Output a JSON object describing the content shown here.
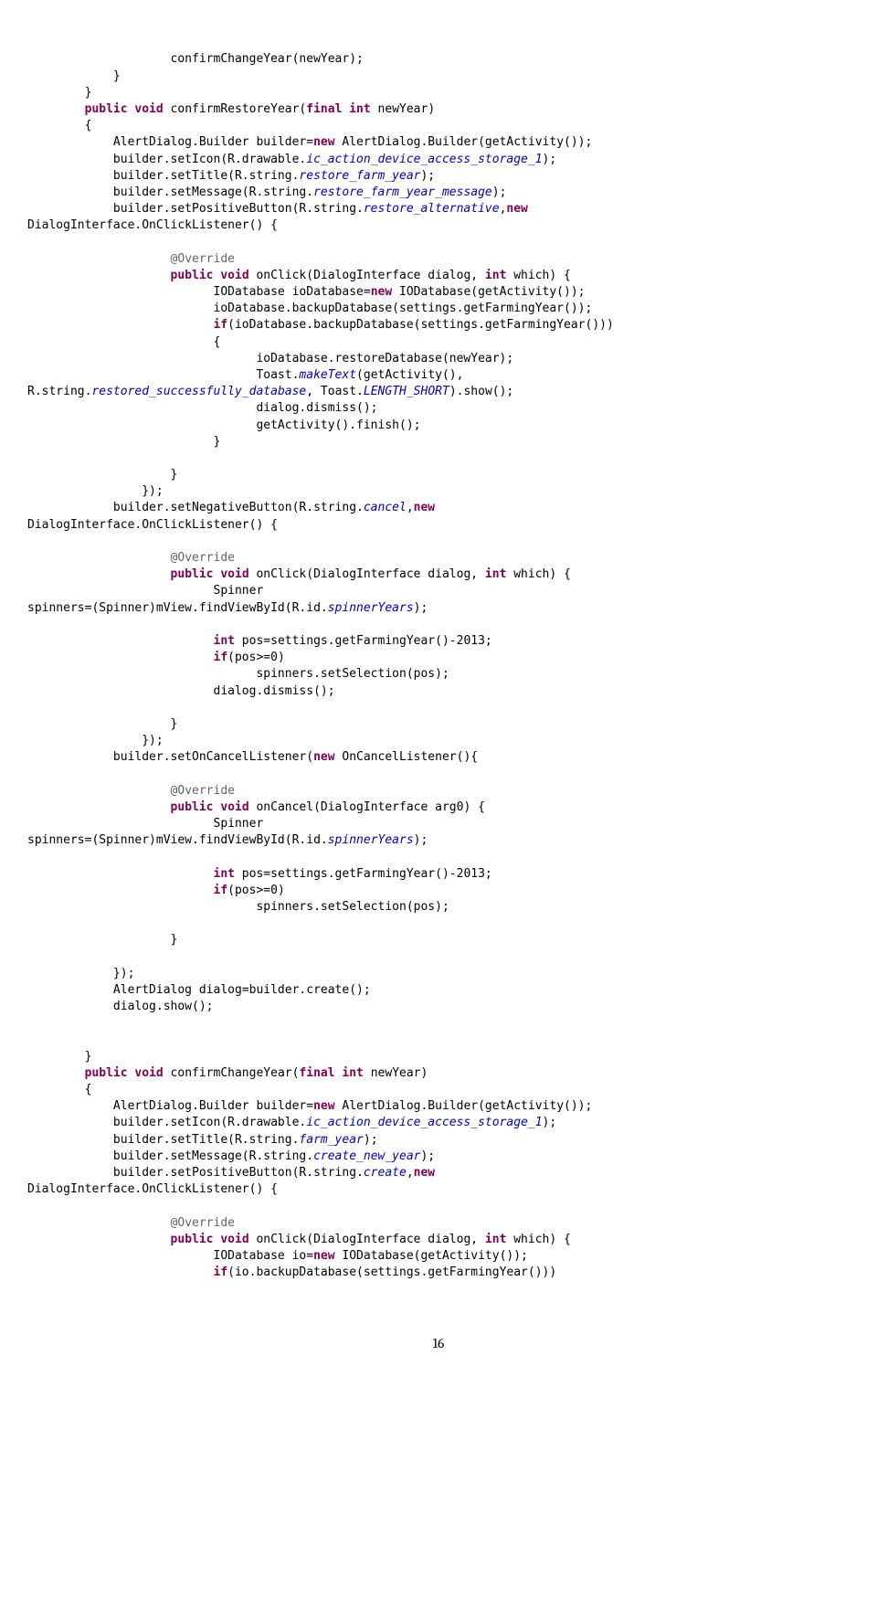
{
  "page_number": "16",
  "t": {
    "l1a": "                    confirmChangeYear(newYear);",
    "l2a": "            }",
    "l3a": "        }",
    "l4a": "        ",
    "l4b": "public void",
    "l4c": " confirmRestoreYear(",
    "l4d": "final int",
    "l4e": " newYear)",
    "l5a": "        {",
    "l6a": "            AlertDialog.Builder builder=",
    "l6b": "new",
    "l6c": " AlertDialog.Builder(getActivity());",
    "l7a": "            builder.setIcon(R.drawable.",
    "l7b": "ic_action_device_access_storage_1",
    "l7c": ");",
    "l8a": "            builder.setTitle(R.string.",
    "l8b": "restore_farm_year",
    "l8c": ");",
    "l9a": "            builder.setMessage(R.string.",
    "l9b": "restore_farm_year_message",
    "l9c": ");",
    "l10a": "            builder.setPositiveButton(R.string.",
    "l10b": "restore_alternative",
    "l10c": ",",
    "l10d": "new",
    "l11a": "DialogInterface.OnClickListener() {",
    "l12a": "",
    "l13a": "                    ",
    "l13b": "@Override",
    "l14a": "                    ",
    "l14b": "public void",
    "l14c": " onClick(DialogInterface dialog, ",
    "l14d": "int",
    "l14e": " which) {",
    "l15a": "                          IODatabase ioDatabase=",
    "l15b": "new",
    "l15c": " IODatabase(getActivity());",
    "l16a": "                          ioDatabase.backupDatabase(settings.getFarmingYear());",
    "l17a": "                          ",
    "l17b": "if",
    "l17c": "(ioDatabase.backupDatabase(settings.getFarmingYear()))",
    "l18a": "                          {",
    "l19a": "                                ioDatabase.restoreDatabase(newYear);",
    "l20a": "                                Toast.",
    "l20b": "makeText",
    "l20c": "(getActivity(),",
    "l21a": "R.string.",
    "l21b": "restored_successfully_database",
    "l21c": ", Toast.",
    "l21d": "LENGTH_SHORT",
    "l21e": ").show();",
    "l22a": "                                dialog.dismiss();",
    "l23a": "                                getActivity().finish();",
    "l24a": "                          }",
    "l25a": "",
    "l26a": "                    }",
    "l27a": "                });",
    "l28a": "            builder.setNegativeButton(R.string.",
    "l28b": "cancel",
    "l28c": ",",
    "l28d": "new",
    "l29a": "DialogInterface.OnClickListener() {",
    "l30a": "",
    "l31a": "                    ",
    "l31b": "@Override",
    "l32a": "                    ",
    "l32b": "public void",
    "l32c": " onClick(DialogInterface dialog, ",
    "l32d": "int",
    "l32e": " which) {",
    "l33a": "                          Spinner",
    "l34a": "spinners=(Spinner)mView.findViewById(R.id.",
    "l34b": "spinnerYears",
    "l34c": ");",
    "l35a": "",
    "l36a": "                          ",
    "l36b": "int",
    "l36c": " pos=settings.getFarmingYear()-2013;",
    "l37a": "                          ",
    "l37b": "if",
    "l37c": "(pos>=0)",
    "l38a": "                                spinners.setSelection(pos);",
    "l39a": "                          dialog.dismiss();",
    "l40a": "",
    "l41a": "                    }",
    "l42a": "                });",
    "l43a": "            builder.setOnCancelListener(",
    "l43b": "new",
    "l43c": " OnCancelListener(){",
    "l44a": "",
    "l45a": "                    ",
    "l45b": "@Override",
    "l46a": "                    ",
    "l46b": "public void",
    "l46c": " onCancel(DialogInterface arg0) {",
    "l47a": "                          Spinner",
    "l48a": "spinners=(Spinner)mView.findViewById(R.id.",
    "l48b": "spinnerYears",
    "l48c": ");",
    "l49a": "",
    "l50a": "                          ",
    "l50b": "int",
    "l50c": " pos=settings.getFarmingYear()-2013;",
    "l51a": "                          ",
    "l51b": "if",
    "l51c": "(pos>=0)",
    "l52a": "                                spinners.setSelection(pos);",
    "l53a": "",
    "l54a": "                    }",
    "l55a": "",
    "l56a": "            });",
    "l57a": "            AlertDialog dialog=builder.create();",
    "l58a": "            dialog.show();",
    "l59a": "",
    "l60a": "",
    "l61a": "        }",
    "l62a": "        ",
    "l62b": "public void",
    "l62c": " confirmChangeYear(",
    "l62d": "final int",
    "l62e": " newYear)",
    "l63a": "        {",
    "l64a": "            AlertDialog.Builder builder=",
    "l64b": "new",
    "l64c": " AlertDialog.Builder(getActivity());",
    "l65a": "            builder.setIcon(R.drawable.",
    "l65b": "ic_action_device_access_storage_1",
    "l65c": ");",
    "l66a": "            builder.setTitle(R.string.",
    "l66b": "farm_year",
    "l66c": ");",
    "l67a": "            builder.setMessage(R.string.",
    "l67b": "create_new_year",
    "l67c": ");",
    "l68a": "            builder.setPositiveButton(R.string.",
    "l68b": "create",
    "l68c": ",",
    "l68d": "new",
    "l69a": "DialogInterface.OnClickListener() {",
    "l70a": "",
    "l71a": "                    ",
    "l71b": "@Override",
    "l72a": "                    ",
    "l72b": "public void",
    "l72c": " onClick(DialogInterface dialog, ",
    "l72d": "int",
    "l72e": " which) {",
    "l73a": "                          IODatabase io=",
    "l73b": "new",
    "l73c": " IODatabase(getActivity());",
    "l74a": "                          ",
    "l74b": "if",
    "l74c": "(io.backupDatabase(settings.getFarmingYear()))"
  }
}
